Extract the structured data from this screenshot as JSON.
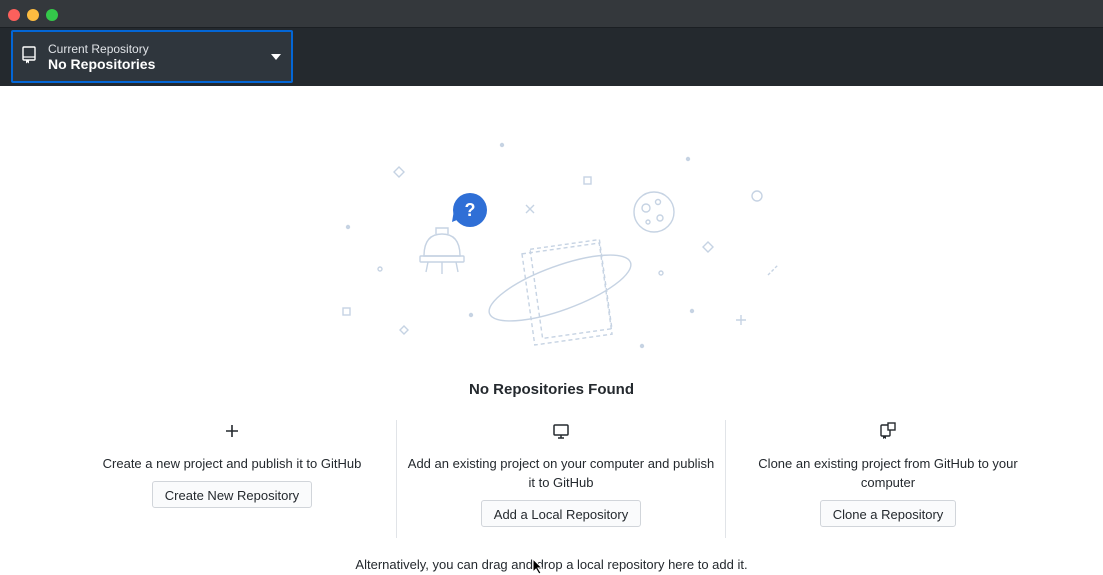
{
  "window": {
    "controls": [
      "close",
      "minimize",
      "maximize"
    ],
    "colors": {
      "close": "#fc605c",
      "minimize": "#fdbc40",
      "maximize": "#34c84a"
    }
  },
  "toolbar": {
    "repository_selector": {
      "description": "Current Repository",
      "title": "No Repositories",
      "icon": "repo-icon",
      "accent": "#0366d6"
    }
  },
  "blankslate": {
    "title": "No Repositories Found",
    "actions": [
      {
        "icon": "plus-icon",
        "description": "Create a new project and publish it to GitHub",
        "button": "Create New Repository"
      },
      {
        "icon": "device-desktop-icon",
        "description": "Add an existing project on your computer and publish it to GitHub",
        "button": "Add a Local Repository"
      },
      {
        "icon": "repo-clone-icon",
        "description": "Clone an existing project from GitHub to your computer",
        "button": "Clone a Repository"
      }
    ],
    "footer": "Alternatively, you can drag and drop a local repository here to add it."
  }
}
